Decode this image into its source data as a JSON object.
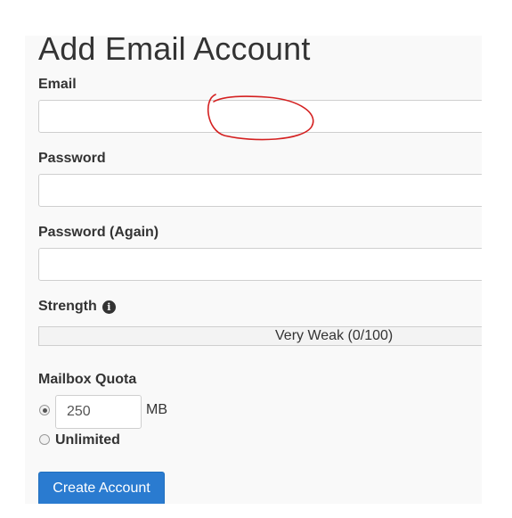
{
  "page": {
    "title": "Add Email Account"
  },
  "form": {
    "email": {
      "label": "Email",
      "value": "",
      "placeholder": ""
    },
    "password": {
      "label": "Password",
      "value": "",
      "placeholder": ""
    },
    "password_again": {
      "label": "Password (Again)",
      "value": "",
      "placeholder": ""
    },
    "strength": {
      "label": "Strength",
      "text": "Very Weak (0/100)",
      "value": 0,
      "icon": "info-icon"
    },
    "quota": {
      "label": "Mailbox Quota",
      "value": "250",
      "unit": "MB",
      "unlimited_label": "Unlimited",
      "selected": "custom"
    },
    "submit_label": "Create Account"
  },
  "colors": {
    "button": "#2a7bd0",
    "annotation": "#d42020",
    "panel_bg": "#f9f9f9"
  }
}
